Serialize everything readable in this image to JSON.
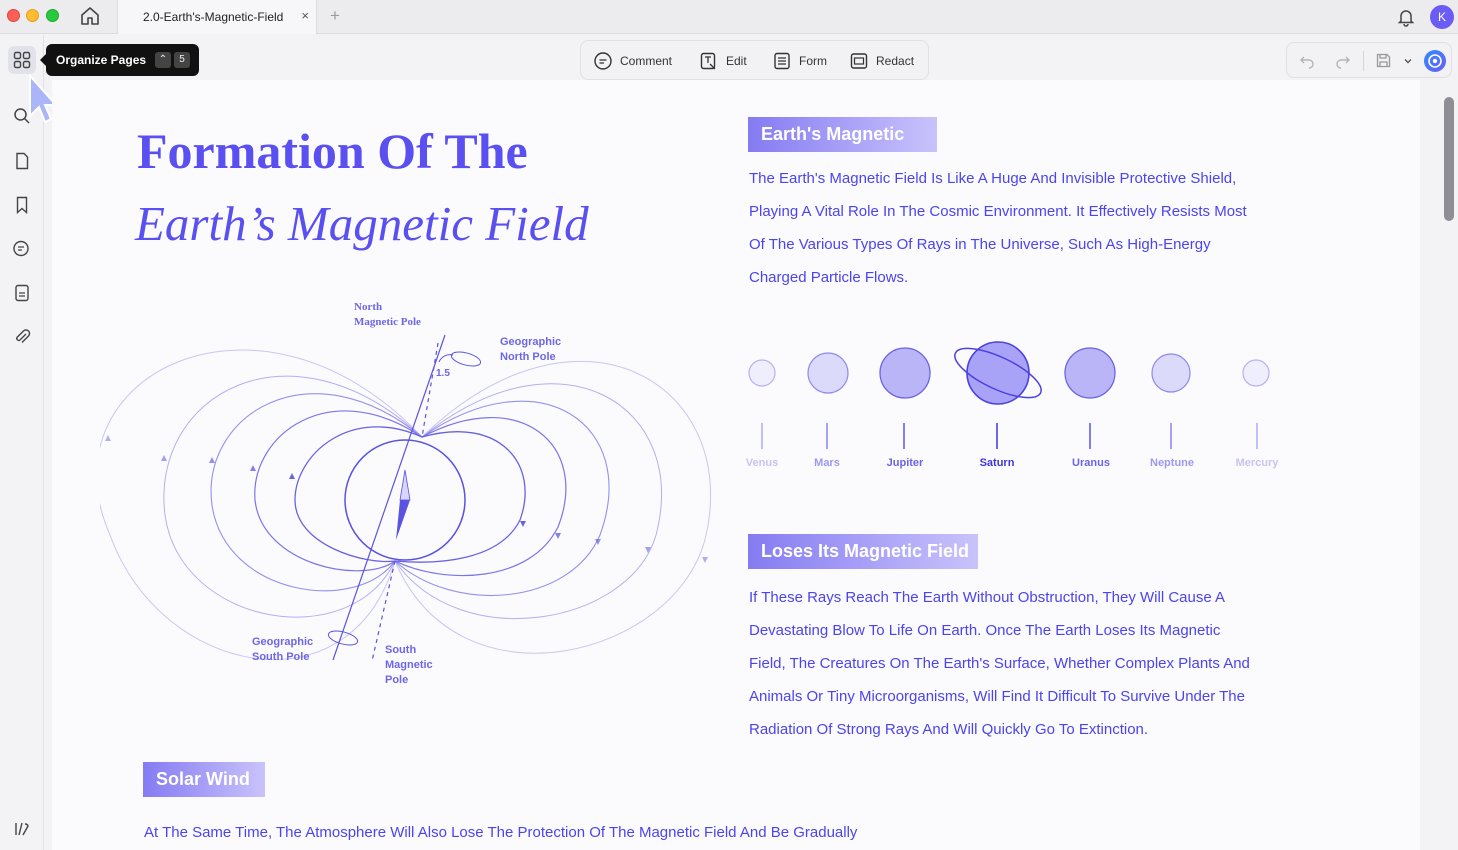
{
  "window": {
    "tab_title": "2.0-Earth's-Magnetic-Field",
    "tab_close": "×",
    "tab_add": "+",
    "avatar_initial": "K"
  },
  "tooltip": {
    "label": "Organize Pages",
    "key1": "⌃",
    "key2": "5"
  },
  "toolbar": {
    "comment": "Comment",
    "edit": "Edit",
    "form": "Form",
    "redact": "Redact"
  },
  "document": {
    "title_line1": "Formation Of The",
    "title_line2": "Earth’s Magnetic Field",
    "section1": {
      "heading": "Earth's Magnetic",
      "lines": [
        "The Earth's Magnetic Field Is Like A Huge And Invisible Protective Shield,",
        "Playing A Vital Role In The Cosmic Environment. It Effectively Resists Most",
        "Of The Various Types Of Rays in The Universe, Such As High-Energy",
        "Charged Particle Flows."
      ]
    },
    "planets": [
      {
        "name": "Venus",
        "color": "#c7c4ee"
      },
      {
        "name": "Mars",
        "color": "#9d98ef"
      },
      {
        "name": "Jupiter",
        "color": "#6c64e6"
      },
      {
        "name": "Saturn",
        "color": "#3f36d8"
      },
      {
        "name": "Uranus",
        "color": "#6c64e6"
      },
      {
        "name": "Neptune",
        "color": "#9d98ef"
      },
      {
        "name": "Mercury",
        "color": "#c7c4ee"
      }
    ],
    "section2": {
      "heading": "Loses Its Magnetic Field",
      "lines": [
        "If These Rays Reach The Earth Without Obstruction, They Will Cause A",
        "Devastating Blow To Life On Earth. Once The Earth Loses Its Magnetic",
        "Field, The Creatures On The Earth's Surface, Whether Complex Plants And",
        "Animals Or Tiny Microorganisms, Will Find It Difficult To Survive Under The",
        "Radiation Of Strong Rays And Will Quickly Go To Extinction."
      ]
    },
    "section3": {
      "heading": "Solar Wind",
      "line": "At The Same Time, The Atmosphere Will Also Lose The Protection Of The Magnetic Field And Be Gradually"
    },
    "diagram": {
      "north_magnetic_pole": [
        "North",
        "Magnetic Pole"
      ],
      "geographic_north_pole": [
        "Geographic",
        "North Pole"
      ],
      "angle": "1.5",
      "geographic_south_pole": [
        "Geographic",
        "South Pole"
      ],
      "south_magnetic_pole": [
        "South",
        "Magnetic",
        "Pole"
      ]
    }
  }
}
